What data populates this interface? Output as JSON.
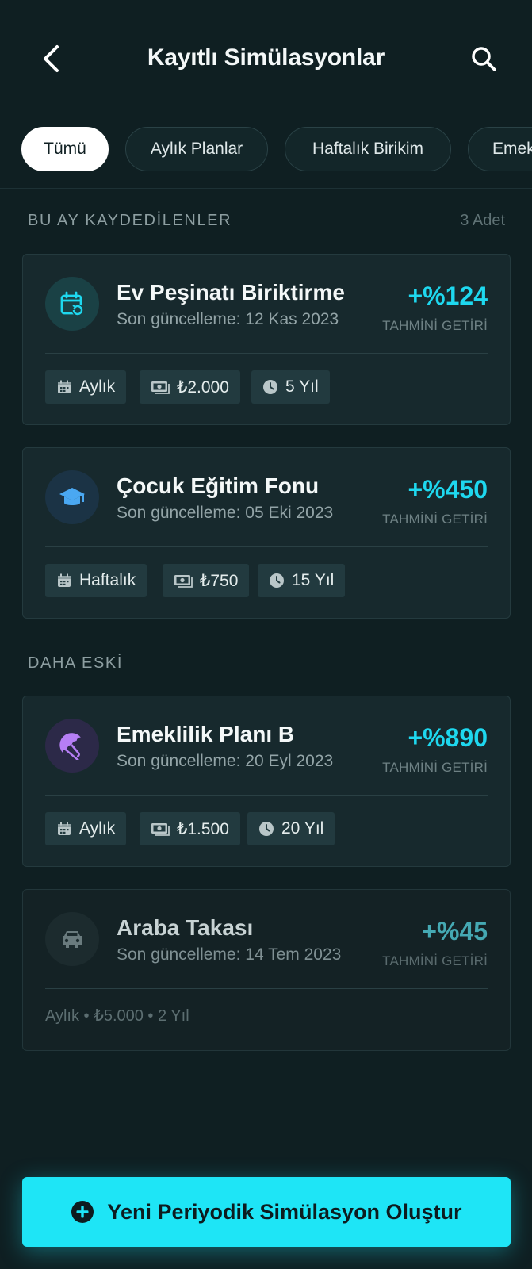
{
  "header": {
    "title": "Kayıtlı Simülasyonlar",
    "back_icon": "chevron-left-icon",
    "search_icon": "search-icon"
  },
  "filters": [
    {
      "label": "Tümü",
      "active": true
    },
    {
      "label": "Aylık Planlar",
      "active": false
    },
    {
      "label": "Haftalık Birikim",
      "active": false
    },
    {
      "label": "Emek",
      "active": false
    }
  ],
  "sections": {
    "this_month": {
      "label": "BU AY KAYDEDİLENLER",
      "count": "3 Adet"
    },
    "older": {
      "label": "DAHA ESKİ"
    }
  },
  "cards": [
    {
      "title": "Ev Peşinatı Biriktirme",
      "updated": "Son güncelleme: 12 Kas 2023",
      "return": "+%124",
      "return_label": "TAHMİNİ GETİRİ",
      "icon": "calendar-refresh-icon",
      "tags": {
        "period": "Aylık",
        "amount": "₺2.000",
        "duration": "5 Yıl"
      }
    },
    {
      "title": "Çocuk Eğitim Fonu",
      "updated": "Son güncelleme: 05 Eki 2023",
      "return": "+%450",
      "return_label": "TAHMİNİ GETİRİ",
      "icon": "graduation-cap-icon",
      "tags": {
        "period": "Haftalık",
        "amount": "₺750",
        "duration": "15 Yıl"
      }
    },
    {
      "title": "Emeklilik Planı B",
      "updated": "Son güncelleme: 20 Eyl 2023",
      "return": "+%890",
      "return_label": "TAHMİNİ GETİRİ",
      "icon": "umbrella-icon",
      "tags": {
        "period": "Aylık",
        "amount": "₺1.500",
        "duration": "20 Yıl"
      }
    },
    {
      "title": "Araba Takası",
      "updated": "Son güncelleme: 14 Tem 2023",
      "return": "+%45",
      "return_label": "TAHMİNİ GETİRİ",
      "icon": "car-icon",
      "meta": "Aylık • ₺5.000 • 2 Yıl"
    }
  ],
  "cta": {
    "label": "Yeni Periyodik Simülasyon Oluştur",
    "icon": "plus-circle-icon"
  },
  "colors": {
    "background": "#0f1f22",
    "accent": "#1ee5f6",
    "card": "#17292d"
  }
}
